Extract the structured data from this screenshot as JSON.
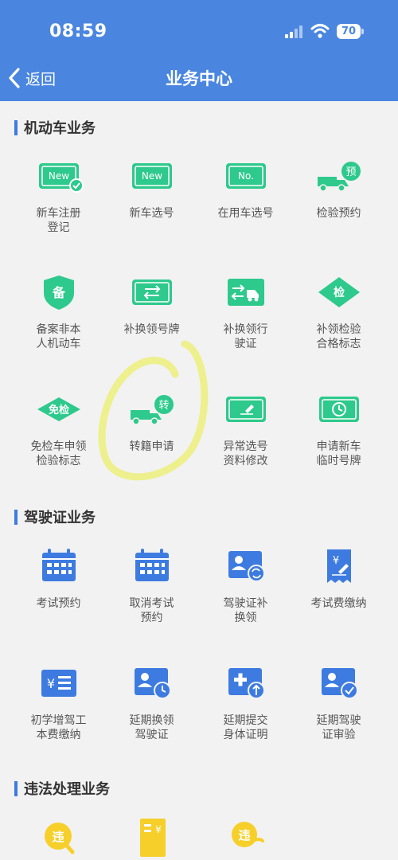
{
  "status_bar": {
    "time": "08:59",
    "battery": "70"
  },
  "nav": {
    "back_label": "返回",
    "title": "业务中心"
  },
  "sections": {
    "vehicle": {
      "title": "机动车业务",
      "items": [
        {
          "label": "新车注册\n登记"
        },
        {
          "label": "新车选号"
        },
        {
          "label": "在用车选号"
        },
        {
          "label": "检验预约"
        },
        {
          "label": "备案非本\n人机动车"
        },
        {
          "label": "补换领号牌"
        },
        {
          "label": "补换领行\n驶证"
        },
        {
          "label": "补领检验\n合格标志"
        },
        {
          "label": "免检车申领\n检验标志"
        },
        {
          "label": "转籍申请"
        },
        {
          "label": "异常选号\n资料修改"
        },
        {
          "label": "申请新车\n临时号牌"
        }
      ]
    },
    "license": {
      "title": "驾驶证业务",
      "items": [
        {
          "label": "考试预约"
        },
        {
          "label": "取消考试\n预约"
        },
        {
          "label": "驾驶证补\n换领"
        },
        {
          "label": "考试费缴纳"
        },
        {
          "label": "初学增驾工\n本费缴纳"
        },
        {
          "label": "延期换领\n驾驶证"
        },
        {
          "label": "延期提交\n身体证明"
        },
        {
          "label": "延期驾驶\n证审验"
        }
      ]
    },
    "violation": {
      "title": "违法处理业务"
    }
  },
  "icon_text": {
    "new": "New",
    "no": "No.",
    "yu": "预",
    "bei": "备",
    "jian": "检",
    "mianjian": "免检",
    "zhuan": "转",
    "wei": "违"
  },
  "colors": {
    "header": "#4a86e0",
    "green": "#2ec98c",
    "blue": "#3d7be0",
    "yellow": "#f6cf2a"
  }
}
